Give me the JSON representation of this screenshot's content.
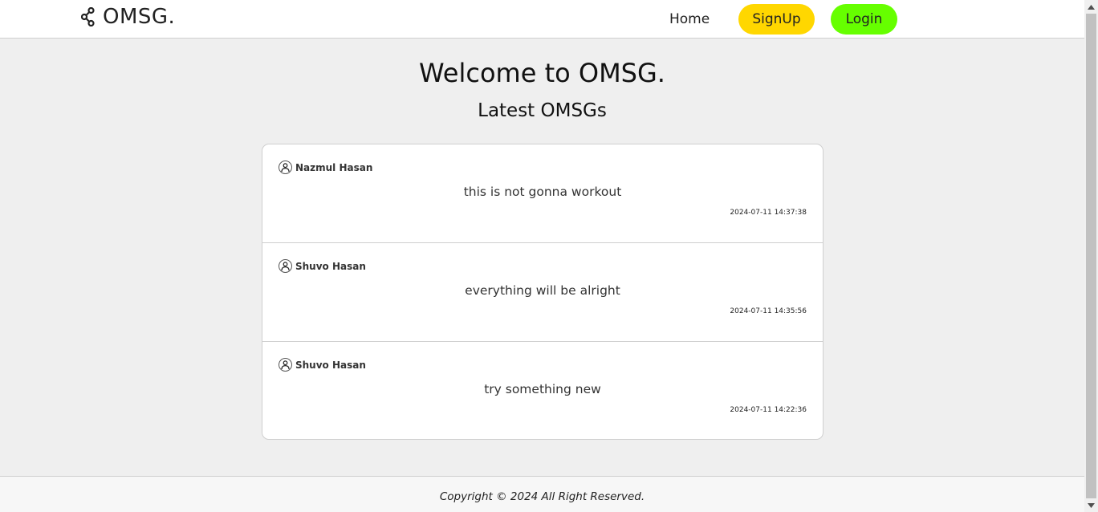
{
  "header": {
    "logo_icon": "share-icon",
    "logo_text": "OMSG.",
    "nav": {
      "home": "Home",
      "signup": "SignUp",
      "login": "Login"
    },
    "colors": {
      "signup": "#ffd700",
      "login": "#66ff00"
    }
  },
  "main": {
    "welcome": "Welcome to OMSG.",
    "latest_title": "Latest OMSGs",
    "messages": [
      {
        "author": "Nazmul Hasan",
        "avatar_icon": "user-icon",
        "text": "this is not gonna workout",
        "time": "2024-07-11 14:37:38"
      },
      {
        "author": "Shuvo Hasan",
        "avatar_icon": "user-icon",
        "text": "everything will be alright",
        "time": "2024-07-11 14:35:56"
      },
      {
        "author": "Shuvo Hasan",
        "avatar_icon": "user-icon",
        "text": "try something new",
        "time": "2024-07-11 14:22:36"
      }
    ]
  },
  "footer": {
    "copyright": "Copyright © 2024 All Right Reserved."
  }
}
